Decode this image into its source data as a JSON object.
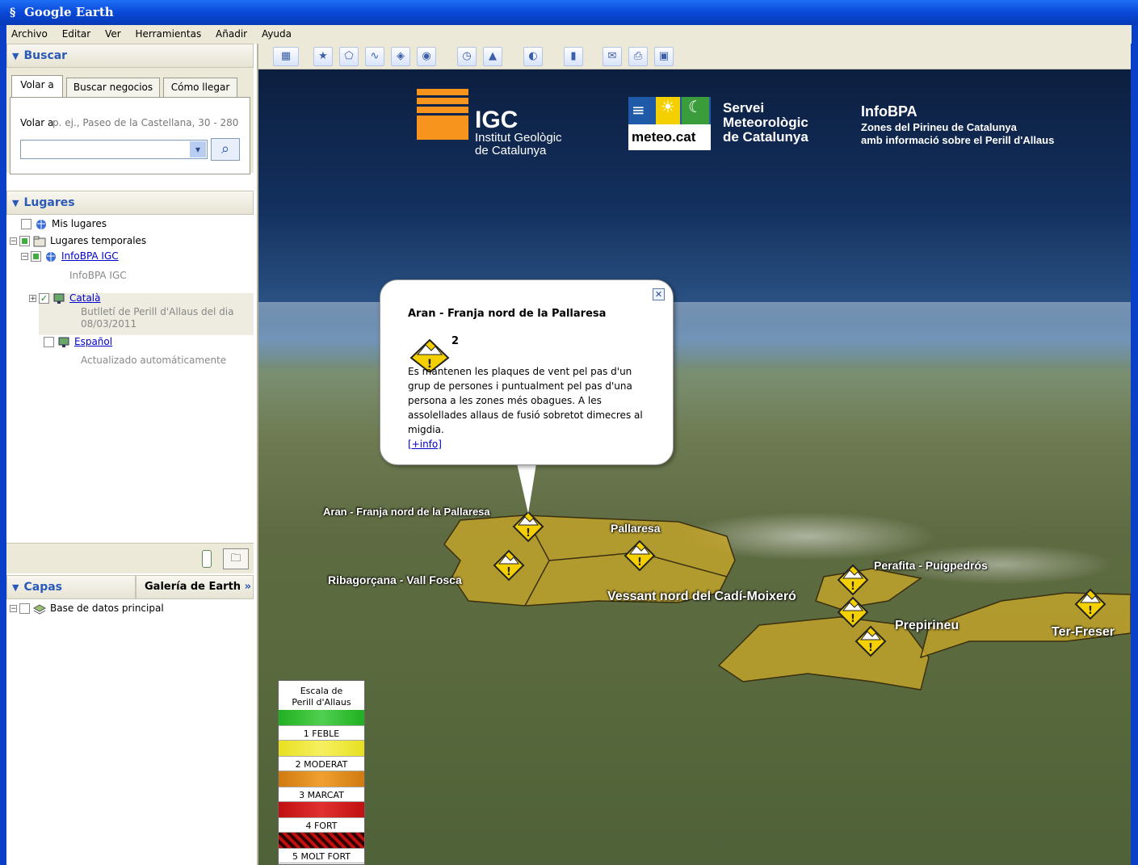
{
  "window": {
    "title": "Google Earth"
  },
  "menu": [
    "Archivo",
    "Editar",
    "Ver",
    "Herramientas",
    "Añadir",
    "Ayuda"
  ],
  "sidebar": {
    "buscar": {
      "header": "Buscar",
      "tabs": [
        "Volar a",
        "Buscar negocios",
        "Cómo llegar"
      ],
      "label": "Volar a",
      "placeholder": "p. ej., Paseo de la Castellana, 30 - 280"
    },
    "lugares": {
      "header": "Lugares",
      "items": [
        {
          "label": "Mis lugares"
        },
        {
          "label": "Lugares temporales"
        },
        {
          "label": "InfoBPA IGC",
          "sub": "InfoBPA IGC"
        },
        {
          "label": "Català",
          "sub": "Butlletí de Perill d'Allaus del dia 08/03/2011"
        },
        {
          "label": "Español",
          "sub": "Actualizado automáticamente"
        }
      ]
    },
    "capas": {
      "header": "Capas",
      "gallery": "Galería de Earth",
      "items": [
        {
          "label": "Base de datos principal"
        }
      ]
    }
  },
  "map": {
    "logos": {
      "igc": {
        "big": "IGC",
        "line1": "Institut Geològic",
        "line2": "de Catalunya"
      },
      "meteo": {
        "box": "meteo.cat",
        "line1": "Servei",
        "line2": "Meteorològic",
        "line3": "de Catalunya"
      },
      "infobpa": {
        "title": "InfoBPA",
        "line1": "Zones del Pirineu de Catalunya",
        "line2": "amb informació sobre el Perill d'Allaus"
      }
    },
    "popup": {
      "title": "Aran - Franja nord de la Pallaresa",
      "level": "2",
      "body": "Es mantenen les plaques de vent pel pas d'un grup de persones i puntualment pel pas d'una persona a les zones més obagues. A les assolellades allaus de fusió sobretot dimecres al migdia.",
      "link": "[+info]"
    },
    "labels": {
      "aran": "Aran - Franja nord de la Pallaresa",
      "pallaresa": "Pallaresa",
      "ribagorcana": "Ribagorçana - Vall Fosca",
      "cadi": "Vessant nord del Cadí-Moixeró",
      "perafita": "Perafita - Puigpedrós",
      "prepirineu": "Prepirineu",
      "terfreser": "Ter-Freser"
    },
    "legend": {
      "title1": "Escala de",
      "title2": "Perill d'Allaus",
      "levels": [
        {
          "label": "1 FEBLE",
          "color": "#22c022"
        },
        {
          "label": "2 MODERAT",
          "color": "#e8e020"
        },
        {
          "label": "3 MARCAT",
          "color": "#e08a10"
        },
        {
          "label": "4 FORT",
          "color": "#d01010"
        },
        {
          "label": "5 MOLT FORT",
          "color": "#c01010"
        }
      ]
    }
  }
}
